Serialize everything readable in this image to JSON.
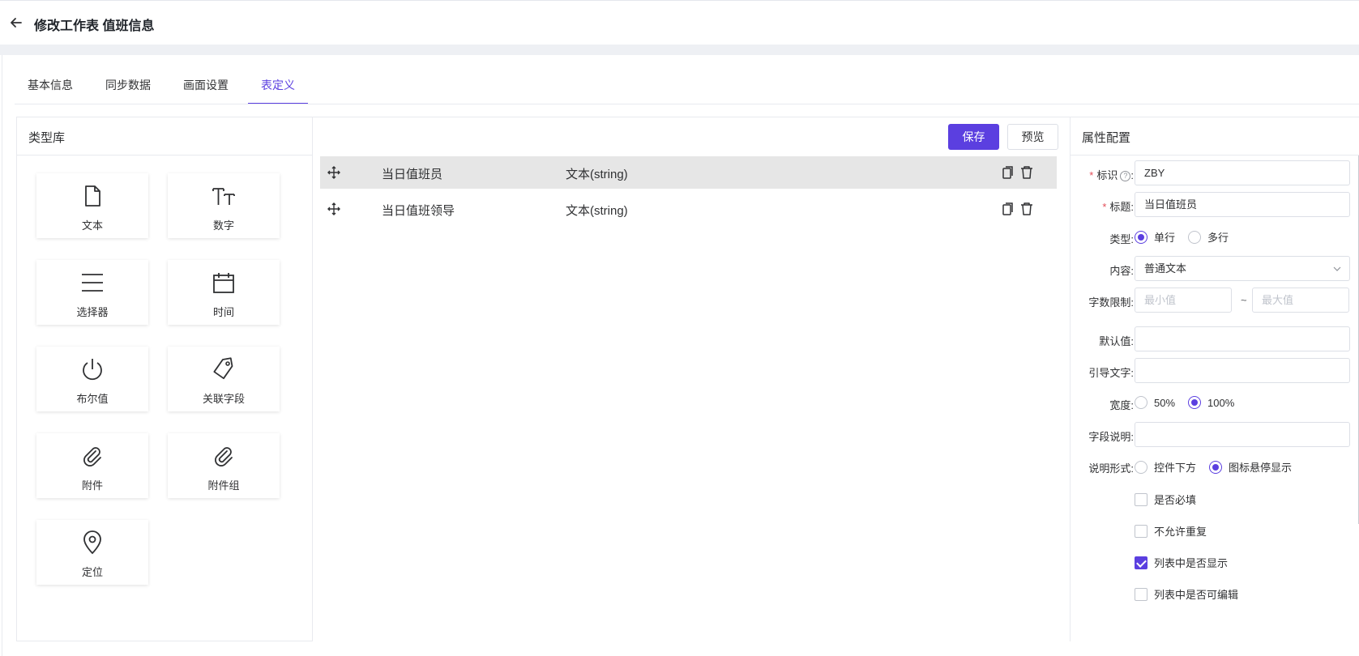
{
  "header": {
    "title": "修改工作表 值班信息",
    "back_icon": "arrow-left-icon"
  },
  "tabs": [
    {
      "label": "基本信息",
      "active": false
    },
    {
      "label": "同步数据",
      "active": false
    },
    {
      "label": "画面设置",
      "active": false
    },
    {
      "label": "表定义",
      "active": true
    }
  ],
  "type_library": {
    "title": "类型库",
    "items": [
      {
        "label": "文本",
        "icon": "document-icon"
      },
      {
        "label": "数字",
        "icon": "text-size-icon"
      },
      {
        "label": "选择器",
        "icon": "menu-lines-icon"
      },
      {
        "label": "时间",
        "icon": "calendar-icon"
      },
      {
        "label": "布尔值",
        "icon": "power-icon"
      },
      {
        "label": "关联字段",
        "icon": "tag-icon"
      },
      {
        "label": "附件",
        "icon": "paperclip-icon"
      },
      {
        "label": "附件组",
        "icon": "paperclip-icon"
      },
      {
        "label": "定位",
        "icon": "location-pin-icon"
      }
    ]
  },
  "toolbar": {
    "save_label": "保存",
    "preview_label": "预览"
  },
  "fields": [
    {
      "name": "当日值班员",
      "type": "文本(string)",
      "selected": true
    },
    {
      "name": "当日值班领导",
      "type": "文本(string)",
      "selected": false
    }
  ],
  "properties": {
    "title": "属性配置",
    "id_label": "标识",
    "id_value": "ZBY",
    "title_label": "标题:",
    "title_value": "当日值班员",
    "type_label": "类型:",
    "type_options": [
      "单行",
      "多行"
    ],
    "type_selected": "单行",
    "content_label": "内容:",
    "content_value": "普通文本",
    "limit_label": "字数限制:",
    "limit_min_placeholder": "最小值",
    "limit_max_placeholder": "最大值",
    "limit_sep": "~",
    "default_label": "默认值:",
    "default_value": "",
    "guide_label": "引导文字:",
    "guide_value": "",
    "width_label": "宽度:",
    "width_options": [
      "50%",
      "100%"
    ],
    "width_selected": "100%",
    "desc_label": "字段说明:",
    "desc_value": "",
    "desc_form_label": "说明形式:",
    "desc_form_options": [
      "控件下方",
      "图标悬停显示"
    ],
    "desc_form_selected": "图标悬停显示",
    "checks": [
      {
        "label": "是否必填",
        "checked": false
      },
      {
        "label": "不允许重复",
        "checked": false
      },
      {
        "label": "列表中是否显示",
        "checked": true
      },
      {
        "label": "列表中是否可编辑",
        "checked": false
      }
    ]
  },
  "colors": {
    "accent": "#5b3fe0",
    "selected_row": "#e6e6e6",
    "required": "#e34d59"
  }
}
